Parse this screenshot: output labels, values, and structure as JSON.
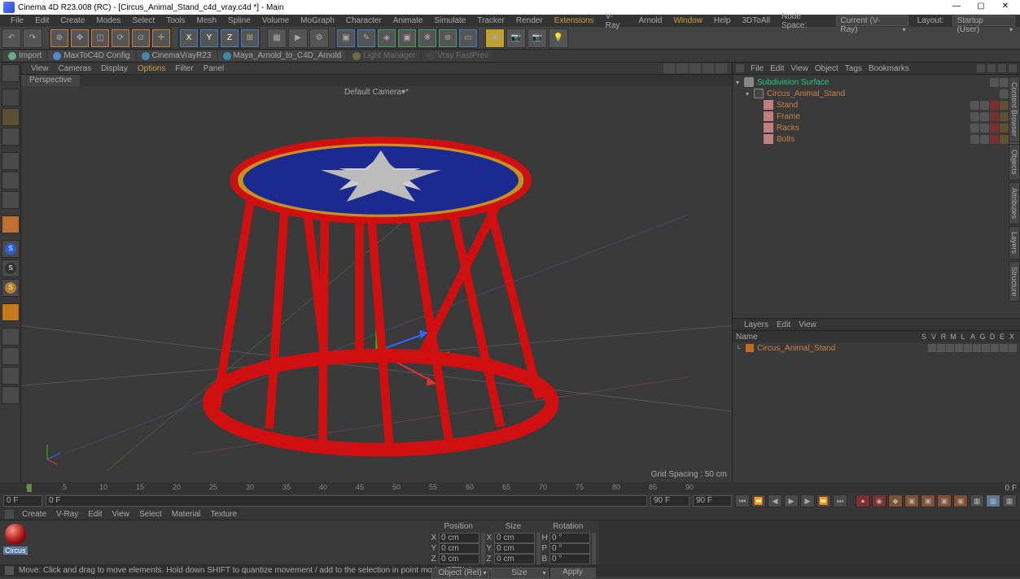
{
  "title": "Cinema 4D R23.008 (RC) - [Circus_Animal_Stand_c4d_vray.c4d *] - Main",
  "menu": [
    "File",
    "Edit",
    "Create",
    "Modes",
    "Select",
    "Tools",
    "Mesh",
    "Spline",
    "Volume",
    "MoGraph",
    "Character",
    "Animate",
    "Simulate",
    "Tracker",
    "Render",
    "Extensions",
    "V-Ray",
    "Arnold",
    "Window",
    "Help",
    "3DToAll"
  ],
  "nodespace": {
    "label": "Node Space:",
    "value": "Current (V-Ray)"
  },
  "layout": {
    "label": "Layout:",
    "value": "Startup (User)"
  },
  "shelf": [
    {
      "label": "Import"
    },
    {
      "label": "MaxToC4D Config"
    },
    {
      "label": "CinemaVrayR23"
    },
    {
      "label": "Maya_Arnold_to_C4D_Arnold"
    },
    {
      "label": "Light Manager",
      "dim": true
    },
    {
      "label": "Vray FastPrev",
      "dim": true
    }
  ],
  "vp_menu": [
    "View",
    "Cameras",
    "Display",
    "Options",
    "Filter",
    "Panel"
  ],
  "vp_tab": "Perspective",
  "vp_camera": "Default Camera▾*",
  "vp_grid": "Grid Spacing : 50 cm",
  "objmgr_menu": [
    "File",
    "Edit",
    "View",
    "Object",
    "Tags",
    "Bookmarks"
  ],
  "tree": [
    {
      "ind": 0,
      "ico": "subdiv",
      "label": "Subdivision Surface",
      "cls": "green",
      "toggle": "▾",
      "dots": 3
    },
    {
      "ind": 1,
      "ico": "null",
      "label": "Circus_Animal_Stand",
      "cls": "orange",
      "toggle": "▾",
      "dots": 2
    },
    {
      "ind": 2,
      "ico": "poly",
      "label": "Stand",
      "cls": "orange",
      "toggle": "",
      "dots": 5
    },
    {
      "ind": 2,
      "ico": "poly",
      "label": "Frame",
      "cls": "orange",
      "toggle": "",
      "dots": 5
    },
    {
      "ind": 2,
      "ico": "poly",
      "label": "Racks",
      "cls": "orange",
      "toggle": "",
      "dots": 5
    },
    {
      "ind": 2,
      "ico": "poly",
      "label": "Bolts",
      "cls": "orange",
      "toggle": "",
      "dots": 5
    }
  ],
  "layers_menu": [
    "Layers",
    "Edit",
    "View"
  ],
  "layer_cols": [
    "Name",
    "S",
    "V",
    "R",
    "M",
    "L",
    "A",
    "G",
    "D",
    "E",
    "X"
  ],
  "layer": {
    "name": "Circus_Animal_Stand"
  },
  "timeline": {
    "min": 0,
    "max": 90,
    "ticks": [
      0,
      5,
      10,
      15,
      20,
      25,
      30,
      35,
      40,
      45,
      50,
      55,
      60,
      65,
      70,
      75,
      80,
      85,
      90
    ]
  },
  "tc": {
    "start": "0 F",
    "cur": "0 F",
    "left": "0 F",
    "end1": "90 F",
    "end2": "90 F",
    "right": "0 F"
  },
  "mat_menu": [
    "Create",
    "V-Ray",
    "Edit",
    "View",
    "Select",
    "Material",
    "Texture"
  ],
  "mat_thumb": "Circus_a",
  "coord": {
    "heads": [
      "Position",
      "Size",
      "Rotation"
    ],
    "rows": [
      {
        "l": "X",
        "p": "0 cm",
        "s": "0 cm",
        "r": "H",
        "rv": "0 °"
      },
      {
        "l": "Y",
        "p": "0 cm",
        "s": "0 cm",
        "r": "P",
        "rv": "0 °"
      },
      {
        "l": "Z",
        "p": "0 cm",
        "s": "0 cm",
        "r": "B",
        "rv": "0 °"
      }
    ],
    "sel1": "Object (Rel)",
    "sel2": "Size",
    "apply": "Apply"
  },
  "status": "Move: Click and drag to move elements. Hold down SHIFT to quantize movement / add to the selection in point mode, CTRL to remove.",
  "side_tabs": [
    "Content Browser",
    "Objects",
    "Attributes",
    "Layers",
    "Structure"
  ]
}
